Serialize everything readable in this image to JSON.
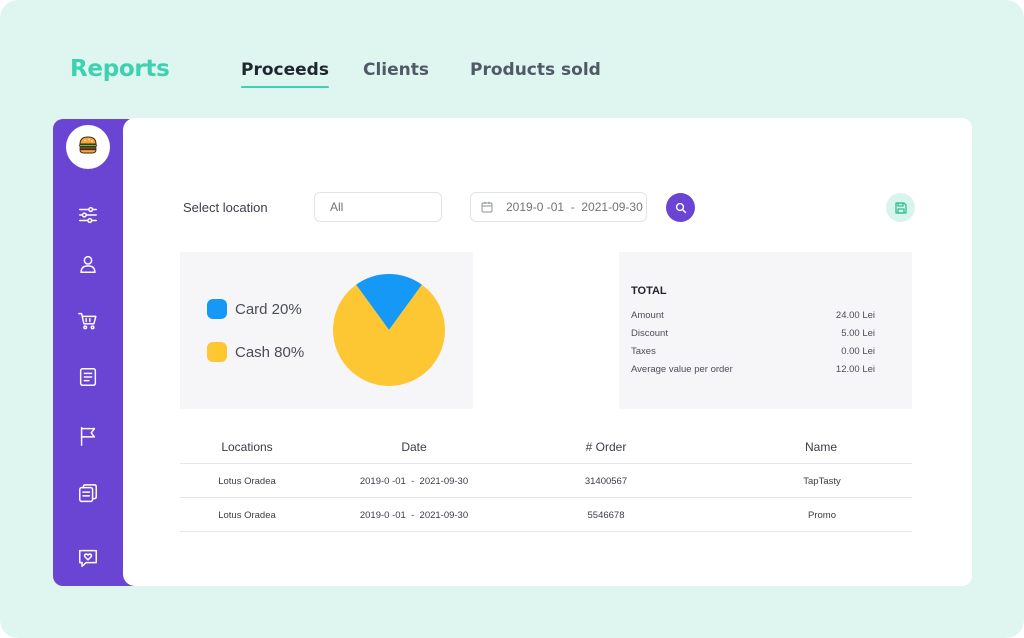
{
  "header": {
    "brand": "Reports",
    "tabs": [
      {
        "label": "Proceeds",
        "active": true
      },
      {
        "label": "Clients",
        "active": false
      },
      {
        "label": "Products sold",
        "active": false
      }
    ]
  },
  "sidebar": {
    "logo_icon": "burger-icon",
    "items": [
      {
        "icon": "sliders-icon"
      },
      {
        "icon": "user-icon"
      },
      {
        "icon": "cart-icon"
      },
      {
        "icon": "document-list-icon"
      },
      {
        "icon": "flag-icon"
      },
      {
        "icon": "receipts-icon"
      },
      {
        "icon": "chat-heart-icon"
      }
    ]
  },
  "filters": {
    "location_label": "Select location",
    "location_value": "All",
    "date_range": "2019-0 -01  -  2021-09-30",
    "search_icon": "search-icon",
    "save_icon": "save-icon"
  },
  "chart_data": {
    "type": "pie",
    "categories": [
      "Card",
      "Cash"
    ],
    "values": [
      20,
      80
    ],
    "colors": [
      "#1699f6",
      "#fdc633"
    ],
    "legend_labels": [
      "Card 20%",
      "Cash 80%"
    ],
    "legend_placement": "left"
  },
  "totals": {
    "title": "TOTAL",
    "rows": [
      {
        "label": "Amount",
        "value": "24.00 Lei"
      },
      {
        "label": "Discount",
        "value": "5.00 Lei"
      },
      {
        "label": "Taxes",
        "value": "0.00 Lei"
      },
      {
        "label": "Average value per order",
        "value": "12.00 Lei"
      }
    ]
  },
  "table": {
    "columns": [
      "Locations",
      "Date",
      "# Order",
      "Name"
    ],
    "rows": [
      [
        "Lotus Oradea",
        "2019-0 -01  -  2021-09-30",
        "31400567",
        "TapTasty"
      ],
      [
        "Lotus Oradea",
        "2019-0 -01  -  2021-09-30",
        "5546678",
        "Promo"
      ]
    ]
  },
  "colors": {
    "background": "#dff6f0",
    "accent_teal": "#3dd1b0",
    "sidebar_purple": "#6a45d4",
    "card_blue": "#1699f6",
    "cash_yellow": "#fdc633"
  }
}
